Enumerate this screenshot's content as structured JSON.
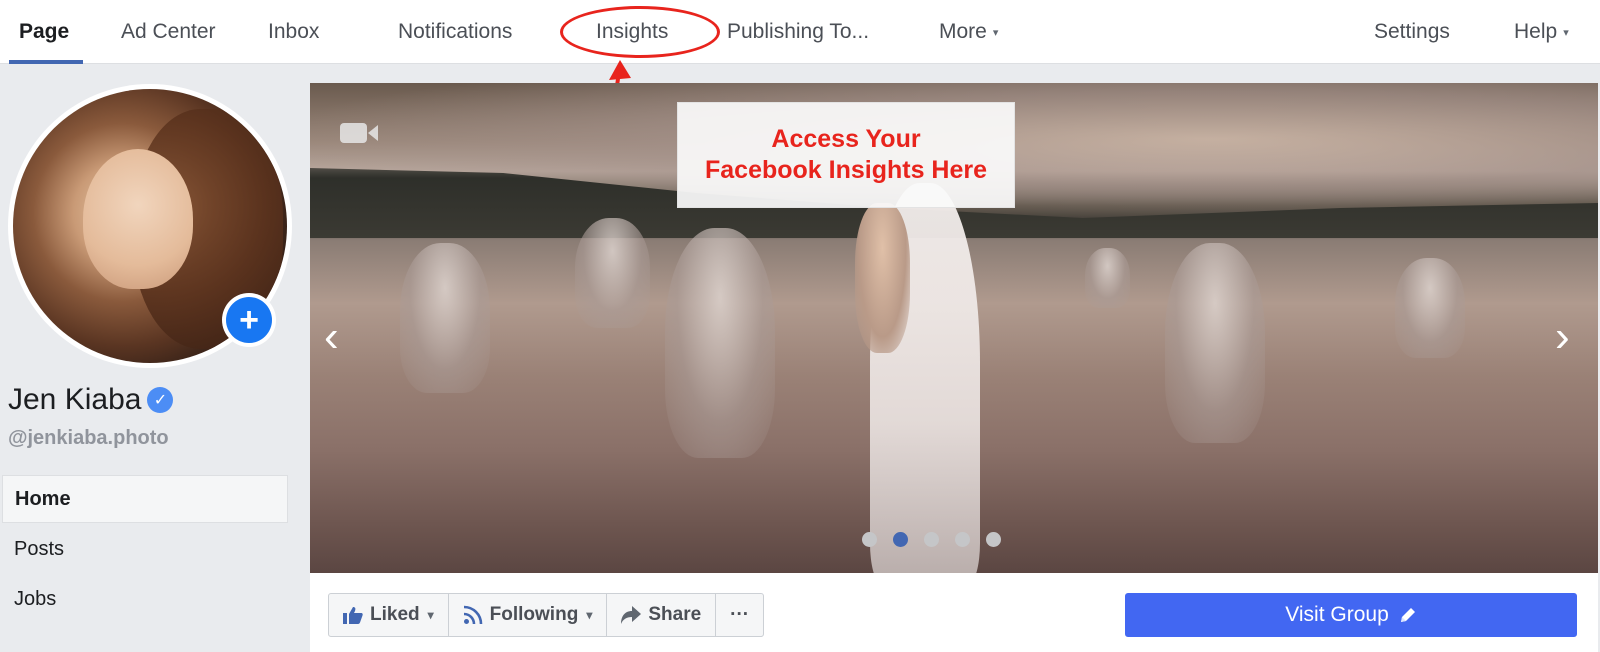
{
  "topnav": {
    "items": [
      {
        "label": "Page"
      },
      {
        "label": "Ad Center"
      },
      {
        "label": "Inbox"
      },
      {
        "label": "Notifications"
      },
      {
        "label": "Insights"
      },
      {
        "label": "Publishing To..."
      },
      {
        "label": "More"
      },
      {
        "label": "Settings"
      },
      {
        "label": "Help"
      }
    ],
    "active_index": 0,
    "caret": "▾"
  },
  "profile": {
    "name": "Jen Kiaba",
    "handle": "@jenkiaba.photo",
    "add_icon": "+",
    "verified_icon": "✓"
  },
  "sidebar": {
    "items": [
      {
        "label": "Home"
      },
      {
        "label": "Posts"
      },
      {
        "label": "Jobs"
      }
    ]
  },
  "cover": {
    "callout_line1": "Access Your",
    "callout_line2": "Facebook Insights Here",
    "prev_icon": "‹",
    "next_icon": "›",
    "dots_count": 5,
    "active_dot": 1
  },
  "actions": {
    "liked": "Liked",
    "following": "Following",
    "share": "Share",
    "more": "···",
    "visit_group": "Visit Group"
  },
  "colors": {
    "accent": "#4267b2",
    "annotation_red": "#e8241d",
    "visit_button": "#4267f2"
  }
}
